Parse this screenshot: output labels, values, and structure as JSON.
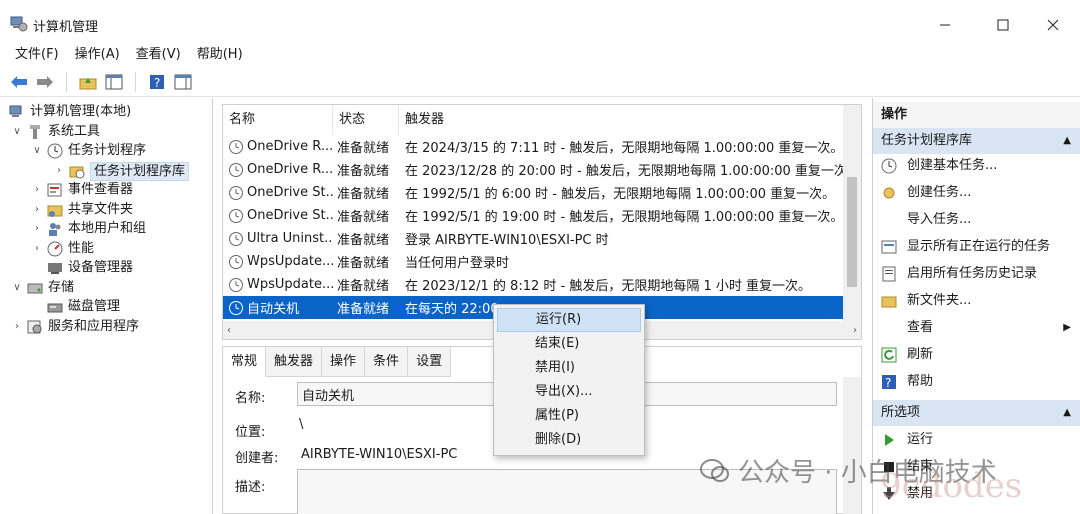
{
  "window": {
    "title": "计算机管理"
  },
  "menu": [
    "文件(F)",
    "操作(A)",
    "查看(V)",
    "帮助(H)"
  ],
  "tree": [
    {
      "label": "计算机管理(本地)",
      "exp": "",
      "level": 0
    },
    {
      "label": "系统工具",
      "exp": "∨",
      "level": 1
    },
    {
      "label": "任务计划程序",
      "exp": "∨",
      "level": 2
    },
    {
      "label": "任务计划程序库",
      "exp": "›",
      "level": 3
    },
    {
      "label": "事件查看器",
      "exp": "›",
      "level": 2
    },
    {
      "label": "共享文件夹",
      "exp": "›",
      "level": 2
    },
    {
      "label": "本地用户和组",
      "exp": "›",
      "level": 2
    },
    {
      "label": "性能",
      "exp": "›",
      "level": 2
    },
    {
      "label": "设备管理器",
      "exp": "",
      "level": 2
    },
    {
      "label": "存储",
      "exp": "∨",
      "level": 1
    },
    {
      "label": "磁盘管理",
      "exp": "",
      "level": 2
    },
    {
      "label": "服务和应用程序",
      "exp": "›",
      "level": 1
    }
  ],
  "list": {
    "headers": [
      "名称",
      "状态",
      "触发器"
    ],
    "rows": [
      {
        "name": "OneDrive R...",
        "status": "准备就绪",
        "trigger": "在 2024/3/15 的 7:11 时 - 触发后，无限期地每隔 1.00:00:00 重复一次。"
      },
      {
        "name": "OneDrive R...",
        "status": "准备就绪",
        "trigger": "在 2023/12/28 的 20:00 时 - 触发后，无限期地每隔 1.00:00:00 重复一次。"
      },
      {
        "name": "OneDrive St...",
        "status": "准备就绪",
        "trigger": "在 1992/5/1 的 6:00 时 - 触发后，无限期地每隔 1.00:00:00 重复一次。"
      },
      {
        "name": "OneDrive St...",
        "status": "准备就绪",
        "trigger": "在 1992/5/1 的 19:00 时 - 触发后，无限期地每隔 1.00:00:00 重复一次。"
      },
      {
        "name": "Ultra Uninst...",
        "status": "准备就绪",
        "trigger": "登录 AIRBYTE-WIN10\\ESXI-PC 时"
      },
      {
        "name": "WpsUpdate...",
        "status": "准备就绪",
        "trigger": "当任何用户登录时"
      },
      {
        "name": "WpsUpdate...",
        "status": "准备就绪",
        "trigger": "在 2023/12/1 的 8:12 时 - 触发后，无限期地每隔 1 小时 重复一次。"
      },
      {
        "name": "自动关机",
        "status": "准备就绪",
        "trigger": "在每天的 22:00"
      }
    ]
  },
  "detail": {
    "tabs": [
      "常规",
      "触发器",
      "操作",
      "条件",
      "设置"
    ],
    "name_label": "名称:",
    "name_value": "自动关机",
    "location_label": "位置:",
    "location_value": "\\",
    "author_label": "创建者:",
    "author_value": "AIRBYTE-WIN10\\ESXI-PC",
    "desc_label": "描述:"
  },
  "context_menu": [
    "运行(R)",
    "结束(E)",
    "禁用(I)",
    "导出(X)...",
    "属性(P)",
    "删除(D)"
  ],
  "actions": {
    "title": "操作",
    "section1": "任务计划程序库",
    "items1": [
      {
        "label": "创建基本任务...",
        "icon": "create-basic-task-icon"
      },
      {
        "label": "创建任务...",
        "icon": "create-task-icon"
      },
      {
        "label": "导入任务...",
        "icon": ""
      },
      {
        "label": "显示所有正在运行的任务",
        "icon": "running-tasks-icon"
      },
      {
        "label": "启用所有任务历史记录",
        "icon": "history-icon"
      },
      {
        "label": "新文件夹...",
        "icon": "folder-icon"
      },
      {
        "label": "查看",
        "icon": "",
        "submenu": true
      },
      {
        "label": "刷新",
        "icon": "refresh-icon"
      },
      {
        "label": "帮助",
        "icon": "help-icon"
      }
    ],
    "section2": "所选项",
    "items2": [
      {
        "label": "运行",
        "icon": "run-icon"
      },
      {
        "label": "结束",
        "icon": "stop-icon"
      },
      {
        "label": "禁用",
        "icon": "disable-icon"
      }
    ]
  },
  "watermark": {
    "text1": "公众号 · 小白电脑技术",
    "text2": "9cdodes"
  }
}
